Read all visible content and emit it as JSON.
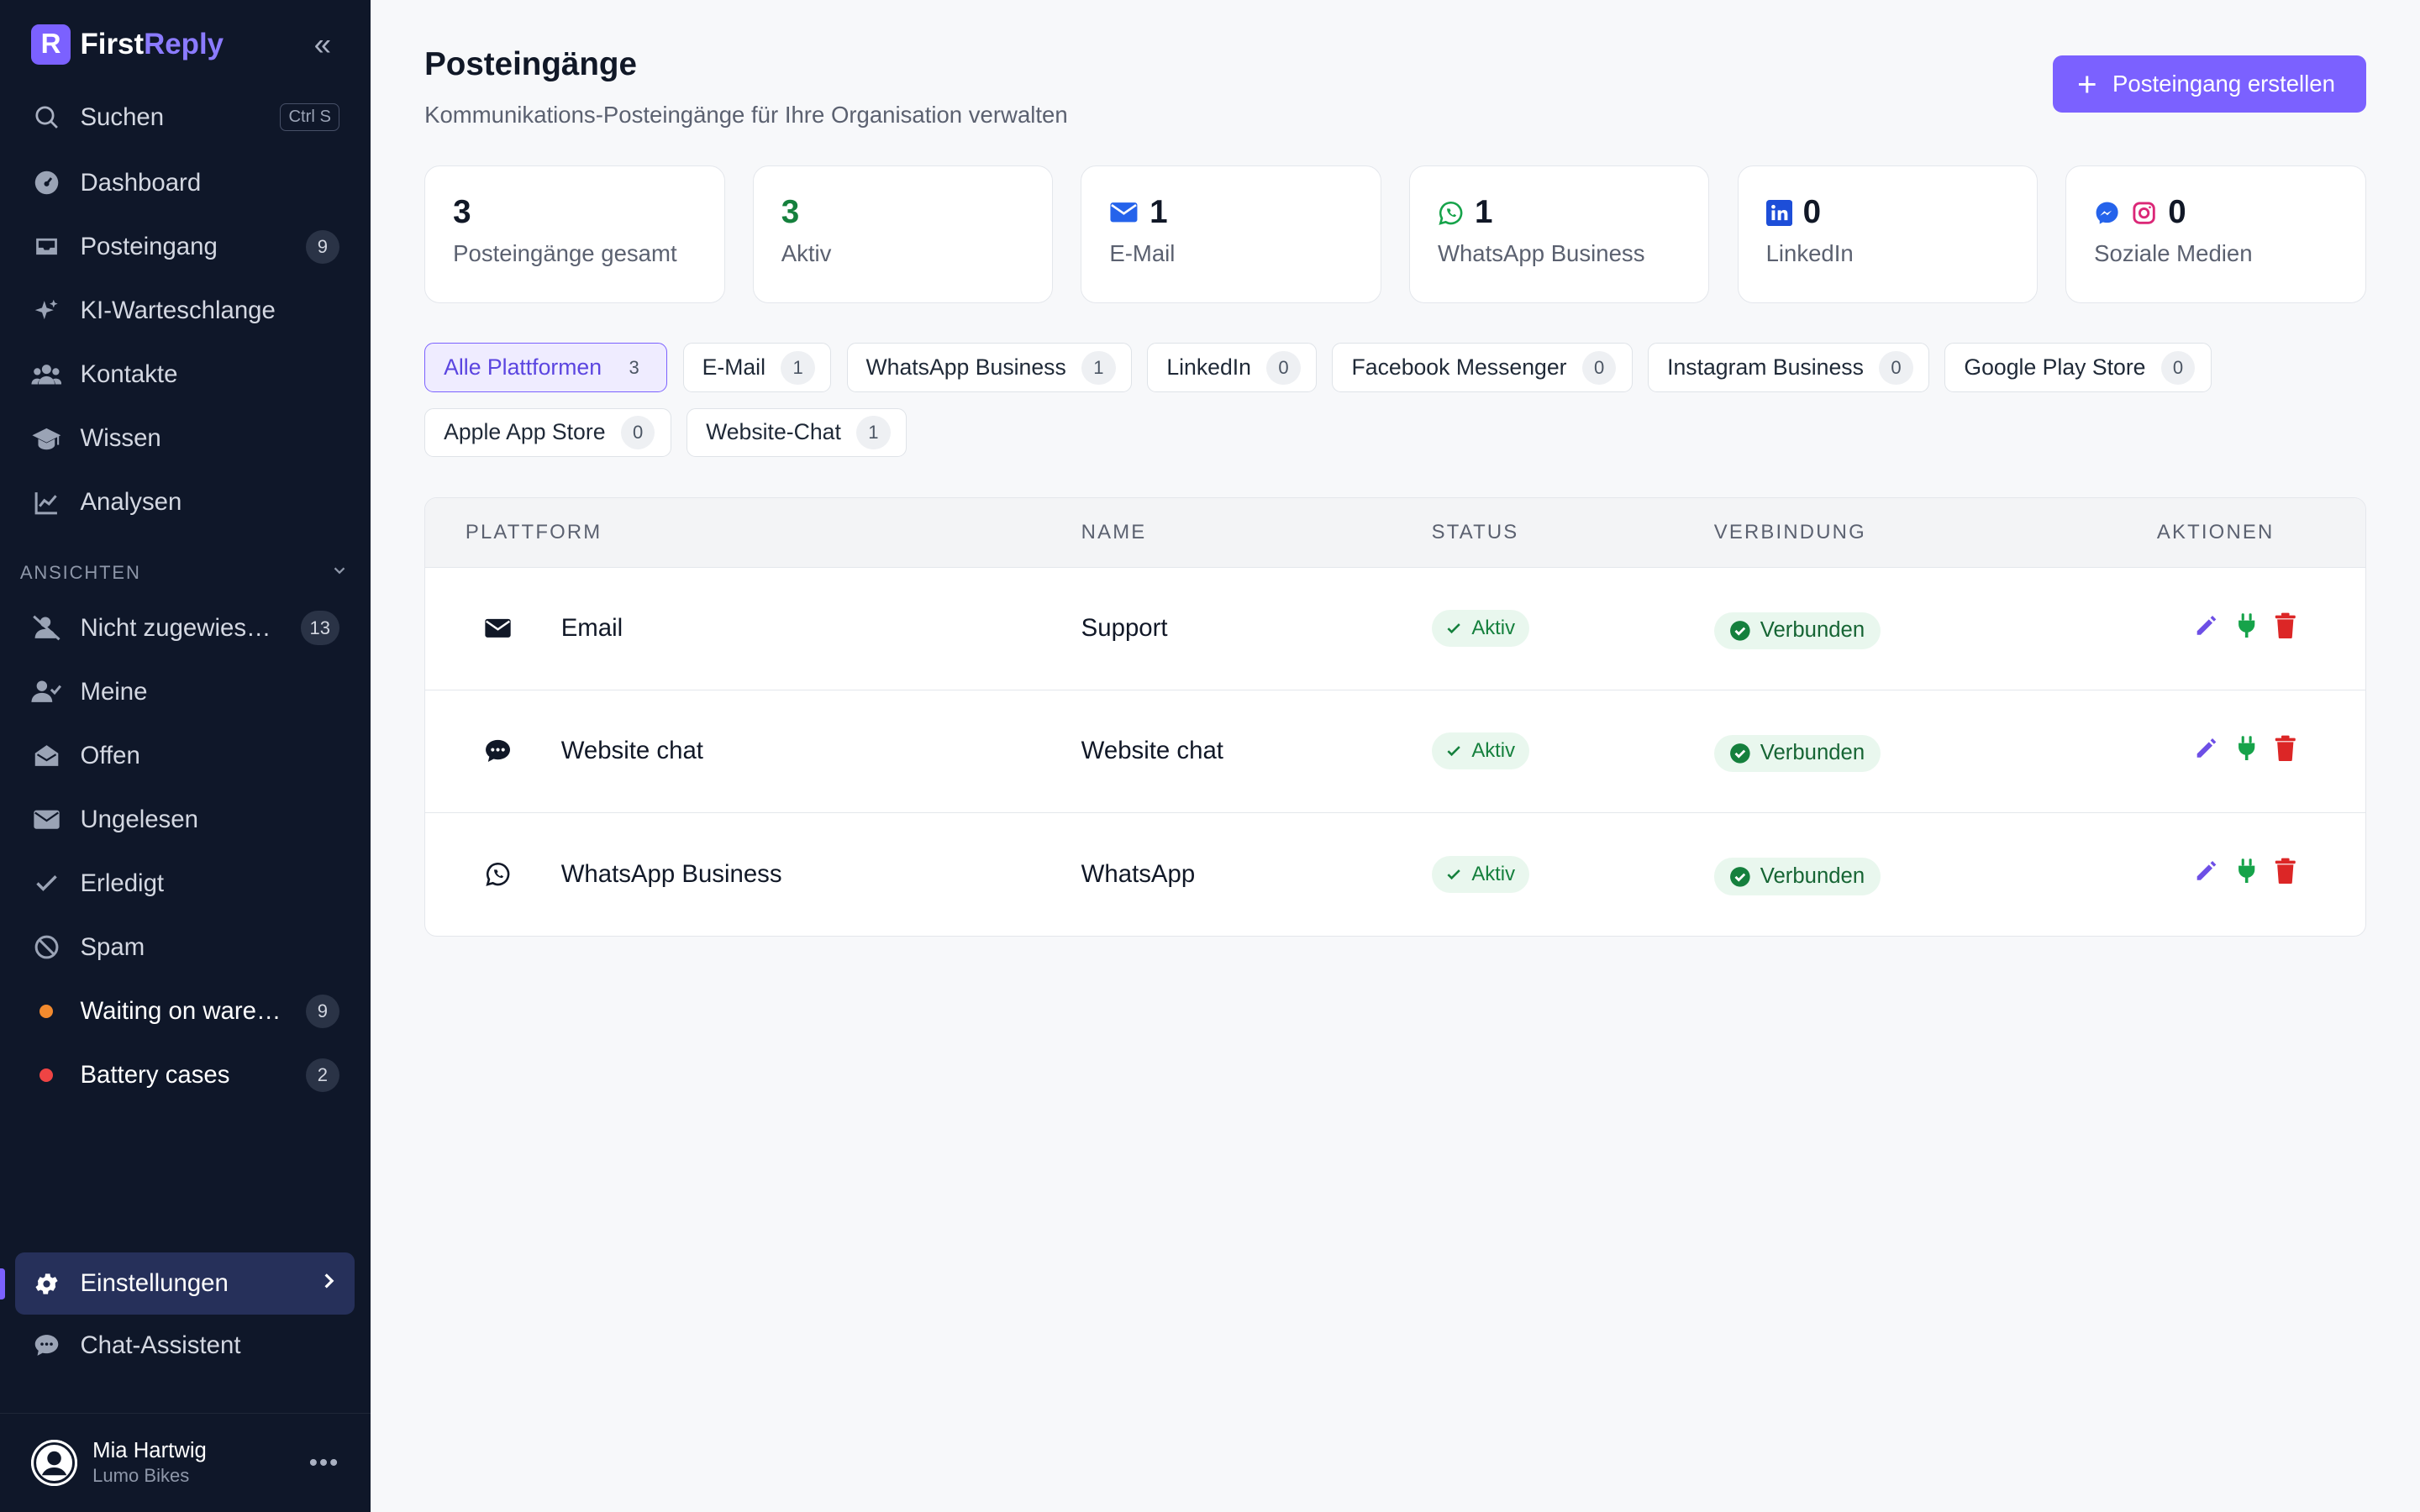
{
  "app": {
    "brand_first": "First",
    "brand_second": "Reply"
  },
  "sidebar": {
    "search_label": "Suchen",
    "search_shortcut": "Ctrl S",
    "nav": [
      {
        "label": "Dashboard",
        "icon": "dashboard-icon"
      },
      {
        "label": "Posteingang",
        "icon": "inbox-icon",
        "badge": "9"
      },
      {
        "label": "KI-Warteschlange",
        "icon": "sparkles-icon"
      },
      {
        "label": "Kontakte",
        "icon": "users-icon"
      },
      {
        "label": "Wissen",
        "icon": "graduation-cap-icon"
      },
      {
        "label": "Analysen",
        "icon": "chart-line-icon"
      }
    ],
    "section_title": "ANSICHTEN",
    "views": [
      {
        "label": "Nicht zugewies…",
        "icon": "user-slash-icon",
        "badge": "13"
      },
      {
        "label": "Meine",
        "icon": "user-check-icon"
      },
      {
        "label": "Offen",
        "icon": "envelope-open-icon"
      },
      {
        "label": "Ungelesen",
        "icon": "envelope-icon"
      },
      {
        "label": "Erledigt",
        "icon": "check-icon"
      },
      {
        "label": "Spam",
        "icon": "ban-icon"
      },
      {
        "label": "Waiting on ware…",
        "dot_color": "#f28a2e",
        "badge": "9"
      },
      {
        "label": "Battery cases",
        "dot_color": "#ef4444",
        "badge": "2"
      }
    ],
    "settings_label": "Einstellungen",
    "chat_assistant_label": "Chat-Assistent",
    "user": {
      "name": "Mia Hartwig",
      "org": "Lumo Bikes"
    }
  },
  "page": {
    "title": "Posteingänge",
    "subtitle": "Kommunikations-Posteingänge für Ihre Organisation verwalten",
    "create_button": "Posteingang erstellen"
  },
  "stats": [
    {
      "value": "3",
      "label": "Posteingänge gesamt",
      "icon": ""
    },
    {
      "value": "3",
      "label": "Aktiv",
      "icon": "",
      "color": "#15803d"
    },
    {
      "value": "1",
      "label": "E-Mail",
      "icon": "envelope-icon"
    },
    {
      "value": "1",
      "label": "WhatsApp Business",
      "icon": "whatsapp-icon"
    },
    {
      "value": "0",
      "label": "LinkedIn",
      "icon": "linkedin-icon"
    },
    {
      "value": "0",
      "label": "Soziale Medien",
      "icon": "messenger-instagram-icon"
    }
  ],
  "filters": [
    {
      "label": "Alle Plattformen",
      "count": "3",
      "active": true
    },
    {
      "label": "E-Mail",
      "count": "1"
    },
    {
      "label": "WhatsApp Business",
      "count": "1"
    },
    {
      "label": "LinkedIn",
      "count": "0"
    },
    {
      "label": "Facebook Messenger",
      "count": "0"
    },
    {
      "label": "Instagram Business",
      "count": "0"
    },
    {
      "label": "Google Play Store",
      "count": "0"
    },
    {
      "label": "Apple App Store",
      "count": "0"
    },
    {
      "label": "Website-Chat",
      "count": "1"
    }
  ],
  "table": {
    "headers": [
      "PLATTFORM",
      "NAME",
      "STATUS",
      "VERBINDUNG",
      "AKTIONEN"
    ],
    "rows": [
      {
        "platform": "Email",
        "platform_icon": "envelope-icon",
        "name": "Support",
        "status": "Aktiv",
        "connection": "Verbunden"
      },
      {
        "platform": "Website chat",
        "platform_icon": "chat-bubble-icon",
        "name": "Website chat",
        "status": "Aktiv",
        "connection": "Verbunden"
      },
      {
        "platform": "WhatsApp Business",
        "platform_icon": "whatsapp-icon",
        "name": "WhatsApp",
        "status": "Aktiv",
        "connection": "Verbunden"
      }
    ]
  },
  "colors": {
    "accent": "#7b61ff",
    "sidebar_bg": "#0f1729",
    "success": "#15803d",
    "danger": "#dc2626",
    "plug": "#16a34a"
  }
}
